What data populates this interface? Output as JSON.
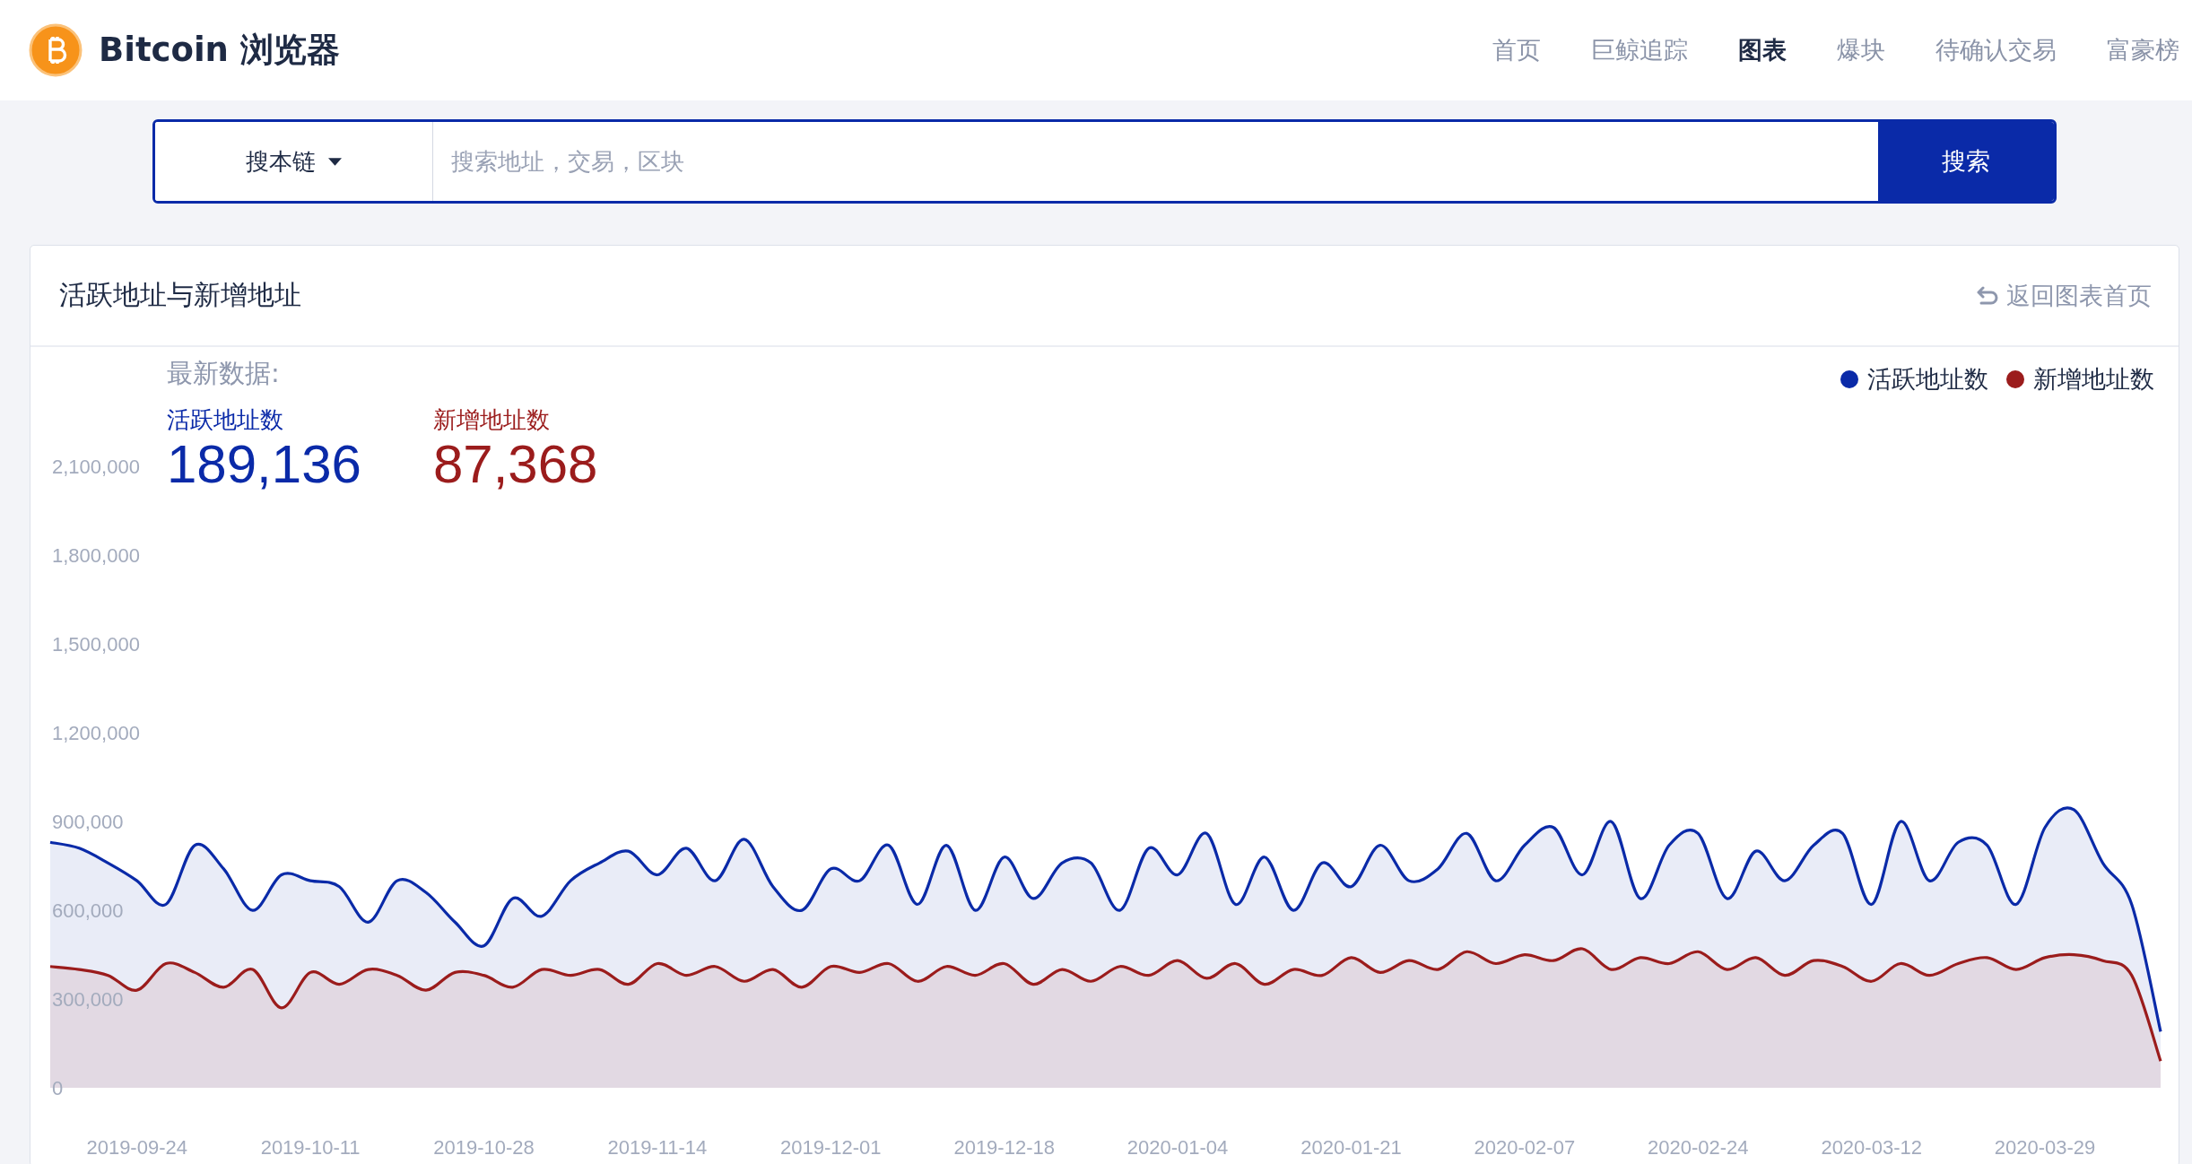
{
  "header": {
    "brand": "Bitcoin 浏览器"
  },
  "nav": [
    {
      "label": "首页",
      "selected": false
    },
    {
      "label": "巨鲸追踪",
      "selected": false
    },
    {
      "label": "图表",
      "selected": true
    },
    {
      "label": "爆块",
      "selected": false
    },
    {
      "label": "待确认交易",
      "selected": false
    },
    {
      "label": "富豪榜",
      "selected": false
    }
  ],
  "search": {
    "scope": "搜本链",
    "placeholder": "搜索地址，交易，区块",
    "button": "搜索"
  },
  "card": {
    "title": "活跃地址与新增地址",
    "back_link": "返回图表首页",
    "latest": {
      "heading": "最新数据:",
      "items": [
        {
          "label": "活跃地址数",
          "value": "189,136",
          "color": "#0a2aa8"
        },
        {
          "label": "新增地址数",
          "value": "87,368",
          "color": "#9b1c1c"
        }
      ]
    },
    "chart_data": {
      "type": "area",
      "categories": [
        null,
        null,
        null,
        "2019-09-24",
        null,
        null,
        null,
        null,
        null,
        "2019-10-11",
        null,
        null,
        null,
        null,
        null,
        "2019-10-28",
        null,
        null,
        null,
        null,
        null,
        "2019-11-14",
        null,
        null,
        null,
        null,
        null,
        "2019-12-01",
        null,
        null,
        null,
        null,
        null,
        "2019-12-18",
        null,
        null,
        null,
        null,
        null,
        "2020-01-04",
        null,
        null,
        null,
        null,
        null,
        "2020-01-21",
        null,
        null,
        null,
        null,
        null,
        "2020-02-07",
        null,
        null,
        null,
        null,
        null,
        "2020-02-24",
        null,
        null,
        null,
        null,
        null,
        "2020-03-12",
        null,
        null,
        null,
        null,
        null,
        "2020-03-29",
        null,
        null,
        null,
        null
      ],
      "series": [
        {
          "name": "活跃地址数",
          "color": "#0a2aa8",
          "values": [
            830000,
            810000,
            760000,
            700000,
            620000,
            820000,
            740000,
            600000,
            720000,
            700000,
            680000,
            560000,
            700000,
            660000,
            560000,
            480000,
            640000,
            580000,
            700000,
            760000,
            800000,
            720000,
            810000,
            700000,
            840000,
            680000,
            600000,
            740000,
            700000,
            820000,
            620000,
            820000,
            600000,
            780000,
            640000,
            760000,
            760000,
            600000,
            810000,
            720000,
            860000,
            620000,
            780000,
            600000,
            760000,
            680000,
            820000,
            700000,
            740000,
            860000,
            700000,
            820000,
            880000,
            720000,
            900000,
            640000,
            820000,
            860000,
            640000,
            800000,
            700000,
            820000,
            860000,
            620000,
            900000,
            700000,
            830000,
            820000,
            620000,
            880000,
            940000,
            760000,
            620000,
            190000
          ]
        },
        {
          "name": "新增地址数",
          "color": "#9b1c1c",
          "values": [
            410000,
            400000,
            380000,
            330000,
            420000,
            390000,
            340000,
            400000,
            270000,
            390000,
            350000,
            400000,
            380000,
            330000,
            390000,
            380000,
            340000,
            400000,
            380000,
            400000,
            350000,
            420000,
            380000,
            410000,
            360000,
            400000,
            340000,
            410000,
            390000,
            420000,
            360000,
            410000,
            380000,
            420000,
            350000,
            400000,
            360000,
            410000,
            380000,
            430000,
            370000,
            420000,
            350000,
            400000,
            380000,
            440000,
            390000,
            430000,
            400000,
            460000,
            420000,
            450000,
            430000,
            470000,
            400000,
            440000,
            420000,
            460000,
            400000,
            440000,
            380000,
            430000,
            410000,
            360000,
            420000,
            380000,
            420000,
            440000,
            400000,
            440000,
            450000,
            430000,
            380000,
            90000
          ]
        }
      ],
      "ylim": [
        0,
        2850000
      ],
      "yticks": [
        {
          "value": 0,
          "label": "0"
        },
        {
          "value": 300000,
          "label": "300,000"
        },
        {
          "value": 600000,
          "label": "600,000"
        },
        {
          "value": 900000,
          "label": "900,000"
        },
        {
          "value": 1200000,
          "label": "1,200,000"
        },
        {
          "value": 1500000,
          "label": "1,500,000"
        },
        {
          "value": 1800000,
          "label": "1,800,000"
        },
        {
          "value": 2100000,
          "label": "2,100,000"
        }
      ]
    }
  }
}
